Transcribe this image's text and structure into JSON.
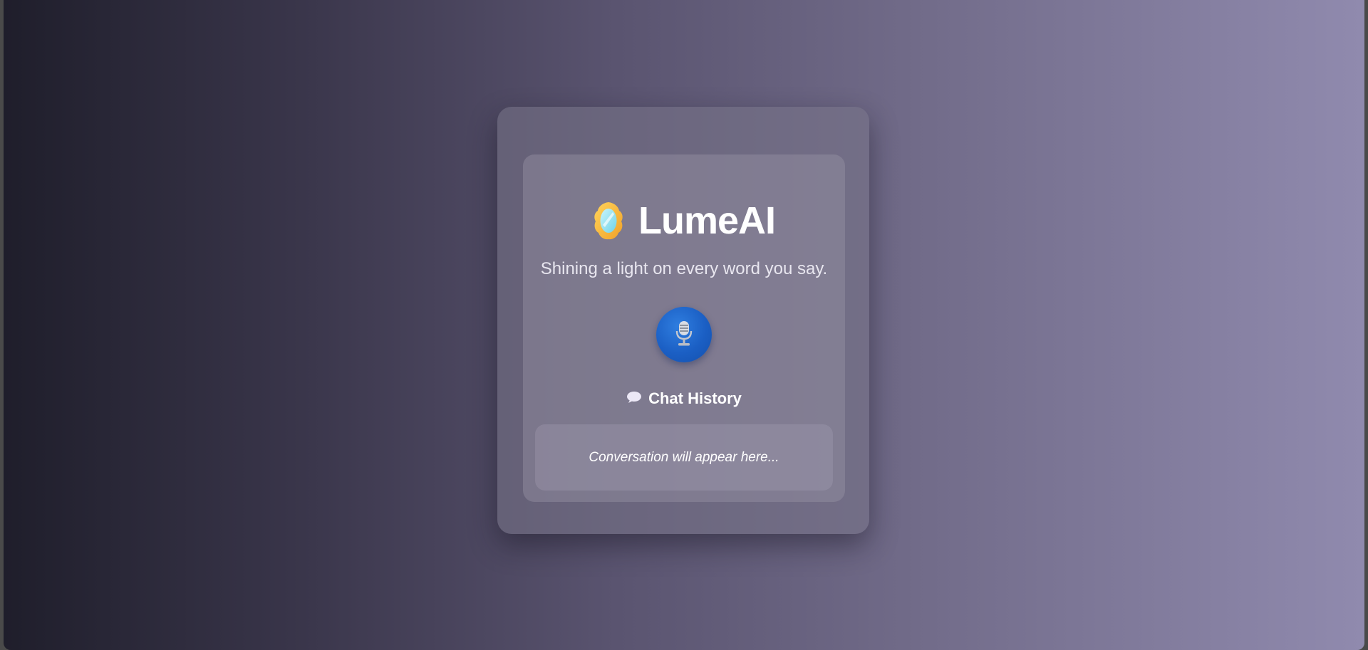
{
  "app": {
    "title": "LumeAI",
    "tagline": "Shining a light on every word you say.",
    "logo_icon": "mirror-icon"
  },
  "mic": {
    "icon": "microphone-icon",
    "color": "#1b5fc4"
  },
  "history": {
    "icon": "speech-bubble-icon",
    "heading": "Chat History",
    "placeholder": "Conversation will appear here..."
  },
  "colors": {
    "background_start": "#1f1e2b",
    "background_end": "#908aae",
    "accent": "#1b5fc4"
  }
}
